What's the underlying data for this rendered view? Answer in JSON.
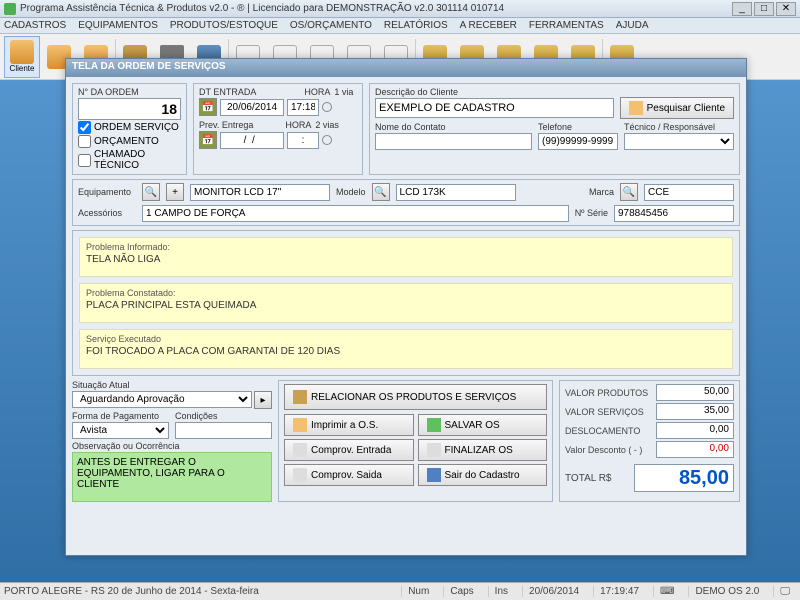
{
  "title": "Programa Assistência Técnica & Produtos v2.0 -                              ® | Licenciado para  DEMONSTRAÇÃO v2.0 301114 010714",
  "menu": [
    "CADASTROS",
    "EQUIPAMENTOS",
    "PRODUTOS/ESTOQUE",
    "OS/ORÇAMENTO",
    "RELATÓRIOS",
    "A RECEBER",
    "FERRAMENTAS",
    "AJUDA"
  ],
  "toolbar_active": "Cliente",
  "dialog": {
    "title": "TELA DA ORDEM DE SERVIÇOS",
    "ordem": {
      "label": "N° DA ORDEM",
      "value": "18"
    },
    "tipo": {
      "ordem_servico": "ORDEM SERVIÇO",
      "orcamento": "ORÇAMENTO",
      "chamado": "CHAMADO TÉCNICO"
    },
    "entrada": {
      "dt_label": "DT ENTRADA",
      "dt": "20/06/2014",
      "hora_label": "HORA",
      "hora": "17:18",
      "via1": "1 via"
    },
    "prev": {
      "label": "Prev. Entrega",
      "dt": "  /  /    ",
      "hora_label": "HORA",
      "hora": ":",
      "via2": "2 vias"
    },
    "cliente": {
      "desc_label": "Descrição do Cliente",
      "desc": "EXEMPLO DE CADASTRO",
      "contato_label": "Nome do Contato",
      "contato": "",
      "tel_label": "Telefone",
      "tel": "(99)99999-9999",
      "tecnico_label": "Técnico / Responsável",
      "pesquisar": "Pesquisar Cliente"
    },
    "equip": {
      "equip_label": "Equipamento",
      "equip": "MONITOR LCD 17''",
      "modelo_label": "Modelo",
      "modelo": "LCD 173K",
      "marca_label": "Marca",
      "marca": "CCE",
      "acess_label": "Acessórios",
      "acess": "1 CAMPO DE FORÇA",
      "serie_label": "Nº Série",
      "serie": "978845456"
    },
    "problemas": {
      "informado_label": "Problema Informado:",
      "informado": "TELA NÃO LIGA",
      "constatado_label": "Problema Constatado:",
      "constatado": "PLACA PRINCIPAL ESTA QUEIMADA",
      "executado_label": "Serviço Executado",
      "executado": "FOI TROCADO A PLACA COM GARANTAI DE 120 DIAS"
    },
    "situacao": {
      "label": "Situação Atual",
      "value": "Aguardando Aprovação",
      "forma_label": "Forma de Pagamento",
      "forma": "Avista",
      "cond_label": "Condições",
      "cond": "",
      "obs_label": "Observação ou Ocorrência",
      "obs": "ANTES DE ENTREGAR O EQUIPAMENTO, LIGAR PARA O CLIENTE"
    },
    "buttons": {
      "relacionar": "RELACIONAR OS PRODUTOS E SERVIÇOS",
      "imprimir": "Imprimir a O.S.",
      "salvar": "SALVAR OS",
      "entrada": "Comprov. Entrada",
      "finalizar": "FINALIZAR OS",
      "saida": "Comprov. Saida",
      "sair": "Sair do Cadastro"
    },
    "valores": {
      "produtos_label": "VALOR PRODUTOS",
      "produtos": "50,00",
      "servicos_label": "VALOR SERVIÇOS",
      "servicos": "35,00",
      "desloc_label": "DESLOCAMENTO",
      "desloc": "0,00",
      "desc_label": "Valor Desconto ( - )",
      "desc": "0,00",
      "total_label": "TOTAL R$",
      "total": "85,00"
    }
  },
  "status": {
    "loc": "PORTO ALEGRE - RS 20 de Junho de 2014 - Sexta-feira",
    "num": "Num",
    "caps": "Caps",
    "ins": "Ins",
    "date": "20/06/2014",
    "time": "17:19:47",
    "demo": "DEMO OS 2.0"
  }
}
